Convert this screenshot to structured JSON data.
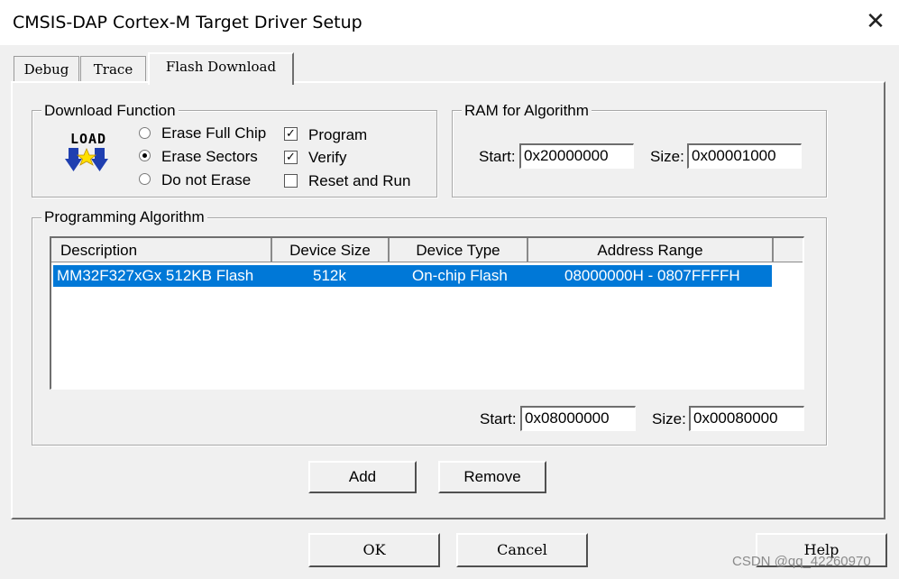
{
  "window": {
    "title": "CMSIS-DAP Cortex-M Target Driver Setup",
    "close_glyph": "✕"
  },
  "tabs": [
    {
      "label": "Debug"
    },
    {
      "label": "Trace"
    },
    {
      "label": "Flash Download",
      "active": true
    }
  ],
  "download_function": {
    "legend": "Download Function",
    "icon": "load-icon",
    "icon_text": "LOAD",
    "erase_options": [
      {
        "label": "Erase Full Chip",
        "selected": false
      },
      {
        "label": "Erase Sectors",
        "selected": true
      },
      {
        "label": "Do not Erase",
        "selected": false
      }
    ],
    "checks": [
      {
        "label": "Program",
        "checked": true,
        "mark": "✓"
      },
      {
        "label": "Verify",
        "checked": true,
        "mark": "✓"
      },
      {
        "label": "Reset and Run",
        "checked": false,
        "mark": ""
      }
    ]
  },
  "ram_for_algorithm": {
    "legend": "RAM for Algorithm",
    "start_label": "Start:",
    "start_value": "0x20000000",
    "size_label": "Size:",
    "size_value": "0x00001000"
  },
  "programming_algorithm": {
    "legend": "Programming Algorithm",
    "columns": [
      "Description",
      "Device Size",
      "Device Type",
      "Address Range"
    ],
    "rows": [
      {
        "description": "MM32F327xGx 512KB Flash",
        "device_size": "512k",
        "device_type": "On-chip Flash",
        "address_range": "08000000H - 0807FFFFH",
        "selected": true
      }
    ],
    "start_label": "Start:",
    "start_value": "0x08000000",
    "size_label": "Size:",
    "size_value": "0x00080000",
    "add_label": "Add",
    "remove_label": "Remove"
  },
  "footer": {
    "ok_label": "OK",
    "cancel_label": "Cancel",
    "help_label": "Help"
  },
  "watermark": "CSDN @qq_42260970",
  "colors": {
    "selection": "#0078d7",
    "dialog_bg": "#f0f0f0"
  }
}
